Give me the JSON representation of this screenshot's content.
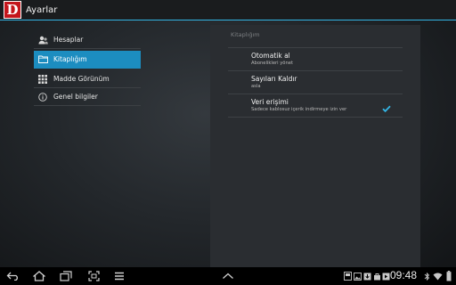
{
  "actionbar": {
    "title": "Ayarlar",
    "logo_letter": "D",
    "logo_color": "#c4161c"
  },
  "sidebar": {
    "items": [
      {
        "label": "Hesaplar",
        "icon": "accounts-icon"
      },
      {
        "label": "Kitaplığım",
        "icon": "folder-icon",
        "active": true
      },
      {
        "label": "Madde Görünüm",
        "icon": "grid-view-icon"
      },
      {
        "label": "Genel bilgiler",
        "icon": "info-icon"
      }
    ]
  },
  "panel": {
    "header": "Kitaplığım",
    "settings": [
      {
        "title": "Otomatik al",
        "summary": "Abonelikleri yönet"
      },
      {
        "title": "Sayıları Kaldır",
        "summary": "asla"
      },
      {
        "title": "Veri erişimi",
        "summary": "Sadece kablosuz içerik indirmeye izin ver",
        "checked": true
      }
    ]
  },
  "navbar": {
    "time": "09:48"
  },
  "colors": {
    "accent": "#33b5e5",
    "active_item": "#1c8dc0"
  }
}
